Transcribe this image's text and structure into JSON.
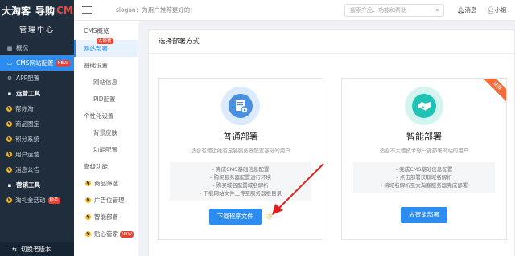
{
  "brand": {
    "logo_a": "大淘客",
    "logo_b": "导购",
    "logo_c": "CMS",
    "subtitle": "管理中心"
  },
  "leftnav": {
    "items": [
      {
        "label": "概况",
        "icon": "grid-icon"
      },
      {
        "label": "CMS网站配置",
        "icon": "monitor-icon",
        "badge": "NEW"
      },
      {
        "label": "APP配置",
        "icon": "gear-icon"
      },
      {
        "label": "运营工具",
        "icon": "tools-icon"
      },
      {
        "label": "帮你淘",
        "icon": "coin-icon"
      },
      {
        "label": "商品圈定",
        "icon": "coin-icon"
      },
      {
        "label": "积分系统",
        "icon": "coin-icon"
      },
      {
        "label": "用户运营",
        "icon": "coin-icon"
      },
      {
        "label": "消息公告",
        "icon": "coin-icon"
      },
      {
        "label": "营销工具",
        "icon": "marketing-icon"
      },
      {
        "label": "淘礼金活动",
        "icon": "coin-icon",
        "badge": "秒杀"
      }
    ],
    "bottom_label": "切换老版本"
  },
  "subnav": {
    "items": [
      {
        "label": "CMS概览"
      },
      {
        "label": "网站部署",
        "badge": "去部署"
      },
      {
        "label": "基础设置"
      },
      {
        "label": "网站信息"
      },
      {
        "label": "PID配置"
      },
      {
        "label": "个性化设置"
      },
      {
        "label": "背景皮肤"
      },
      {
        "label": "功能配置"
      },
      {
        "label": "高级功能"
      },
      {
        "label": "商品筛选"
      },
      {
        "label": "广告位管理"
      },
      {
        "label": "智能部署"
      },
      {
        "label": "贴心管家",
        "badge": "NEW"
      }
    ]
  },
  "header": {
    "slogan": "slogan：为用户推荐更好的！",
    "search_placeholder": "搜索产品、功能和帮助",
    "messages": "消息",
    "user": "小姐"
  },
  "main": {
    "title": "选择部署方式",
    "options": [
      {
        "title": "普通部署",
        "subtitle": "适合有懂运维有足够服务器配置基础的用户",
        "features": [
          "- 完成CMS基础信息配置",
          "- 购买服务器配置运行环境",
          "- 购买域名配置域名解析",
          "- 下载网站文件上传至服务器根目录"
        ],
        "button": "下载程序文件",
        "color": "#2d8cf0"
      },
      {
        "title": "智能部署",
        "subtitle": "适合不太懂技术想一键部署网站的用户",
        "features": [
          "- 完成CMS基础信息配置",
          "- 点击部署获取域名解析",
          "- 将域名解析至大淘客服务器完成部署"
        ],
        "button": "去智能部署",
        "ribbon": "推荐",
        "color": "#1fc2b5"
      }
    ]
  }
}
